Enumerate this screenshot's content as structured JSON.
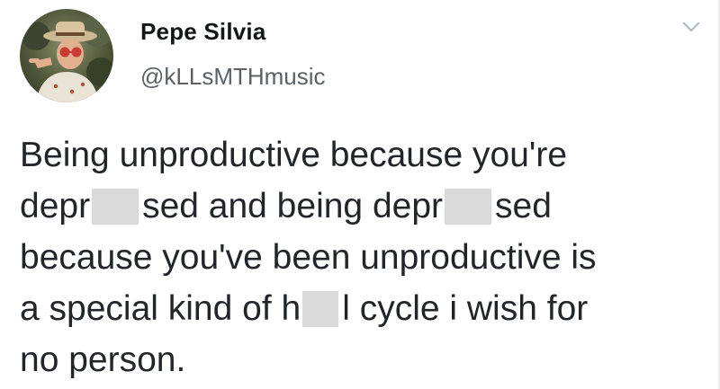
{
  "user": {
    "display_name": "Pepe Silvia",
    "handle": "@kLLsMTHmusic"
  },
  "tweet": {
    "segments": {
      "l1": "Being unproductive because you're",
      "l2a": "depr",
      "l2b": "sed and being depr",
      "l2c": "sed",
      "l3": "because you've been unproductive is",
      "l4a": "a special kind of h",
      "l4b": "l cycle i wish for",
      "l5": "no person."
    }
  },
  "icons": {
    "menu": "chevron-down-icon",
    "avatar": "avatar"
  },
  "colors": {
    "name": "#14171a",
    "handle": "#5b6167",
    "text": "#22262a",
    "redaction": "#dadada",
    "caret": "#aab8c2"
  }
}
